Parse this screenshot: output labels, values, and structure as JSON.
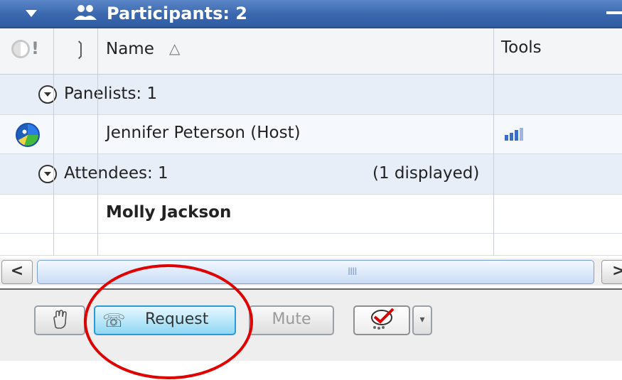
{
  "panel": {
    "title": "Participants: 2",
    "colors": {
      "titlebar": "#3a67ad",
      "annotation": "#e00000",
      "request_button": "#8fd7f3"
    }
  },
  "grid": {
    "headers": {
      "status_icon": "status-exclamation-icon",
      "phone_icon": "phone-icon",
      "name": "Name",
      "sort_indicator": "△",
      "tools": "Tools"
    },
    "panelists": {
      "label": "Panelists: 1"
    },
    "attendees": {
      "label": "Attendees: 1",
      "displayed": "(1 displayed)"
    },
    "rows": [
      {
        "name": "Jennifer Peterson (Host)",
        "status_icon": "globe-icon",
        "tools_icon": "signal-bars-icon"
      },
      {
        "name": "Molly Jackson"
      }
    ]
  },
  "scrollbar": {
    "left_arrow": "<",
    "right_arrow": ">",
    "grip": "IIII"
  },
  "toolbar": {
    "hand_icon": "raise-hand-icon",
    "request_label": "Request",
    "mute_label": "Mute",
    "poll_icon": "checkmark-poll-icon",
    "dropdown_arrow": "▾"
  }
}
